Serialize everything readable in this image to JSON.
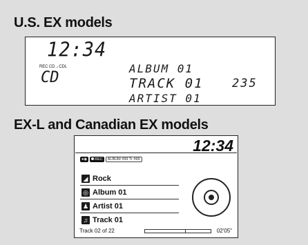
{
  "us_section": {
    "heading": "U.S. EX models",
    "display": {
      "clock": "12:34",
      "mode_indicator": "REC CD→CDL",
      "source": "CD",
      "album": "ALBUM 01",
      "track": "TRACK 01",
      "count": "235",
      "artist": "ARTIST 01"
    }
  },
  "exl_section": {
    "heading": "EX-L and Canadian EX models",
    "display": {
      "clock": "12:34",
      "status": {
        "rec": "REC",
        "album_number": "ALBUM #99",
        "track_number": "Tr #99"
      },
      "rows": [
        {
          "icon": "folder-icon",
          "label": "Rock"
        },
        {
          "icon": "album-icon",
          "label": "Album 01"
        },
        {
          "icon": "artist-icon",
          "label": "Artist 01"
        },
        {
          "icon": "music-note-icon",
          "label": "Track 01"
        }
      ],
      "track_position": "Track 02 of 22",
      "progress_fraction": 0.62,
      "elapsed": "02'05\""
    }
  }
}
